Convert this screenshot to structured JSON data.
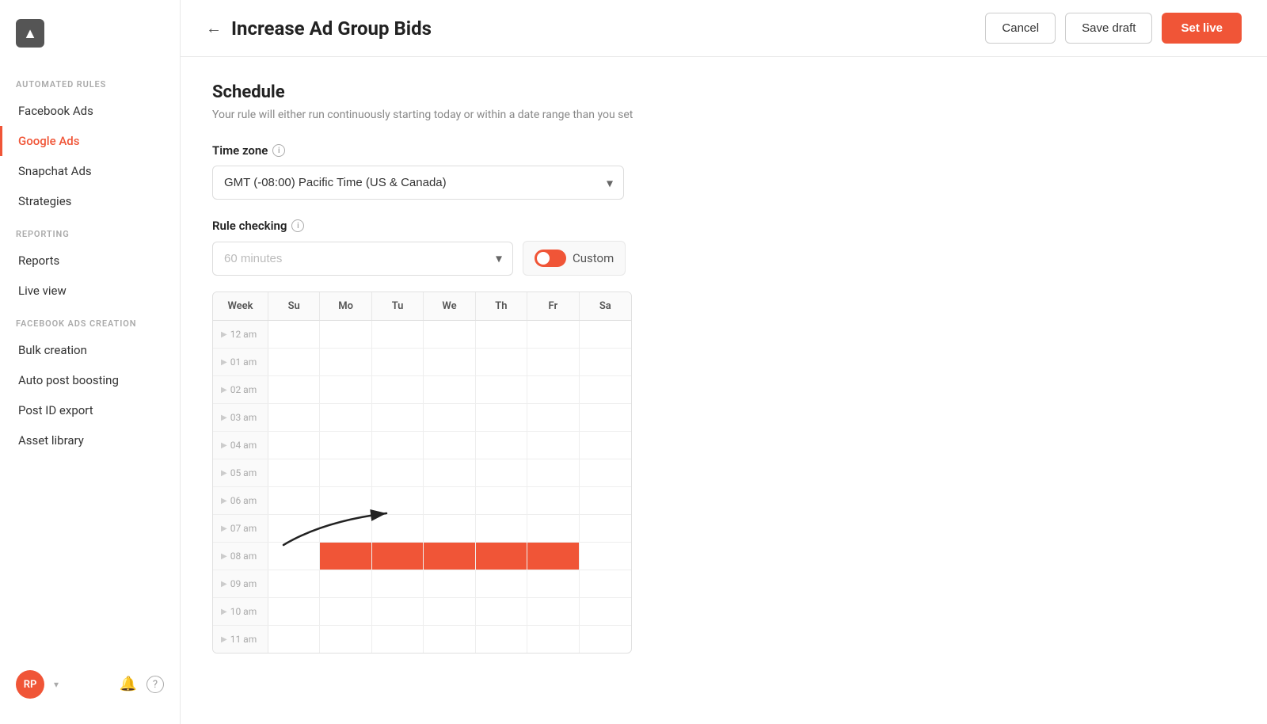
{
  "sidebar": {
    "logo_icon": "▲",
    "sections": [
      {
        "label": "AUTOMATED RULES",
        "items": [
          {
            "id": "facebook-ads",
            "label": "Facebook Ads",
            "active": false
          },
          {
            "id": "google-ads",
            "label": "Google Ads",
            "active": true
          },
          {
            "id": "snapchat-ads",
            "label": "Snapchat Ads",
            "active": false
          },
          {
            "id": "strategies",
            "label": "Strategies",
            "active": false
          }
        ]
      },
      {
        "label": "REPORTING",
        "items": [
          {
            "id": "reports",
            "label": "Reports",
            "active": false
          },
          {
            "id": "live-view",
            "label": "Live view",
            "active": false
          }
        ]
      },
      {
        "label": "FACEBOOK ADS CREATION",
        "items": [
          {
            "id": "bulk-creation",
            "label": "Bulk creation",
            "active": false
          },
          {
            "id": "auto-post-boosting",
            "label": "Auto post boosting",
            "active": false
          },
          {
            "id": "post-id-export",
            "label": "Post ID export",
            "active": false
          },
          {
            "id": "asset-library",
            "label": "Asset library",
            "active": false
          }
        ]
      }
    ],
    "footer": {
      "avatar_initials": "RP",
      "chevron_icon": "▾",
      "bell_icon": "🔔",
      "help_icon": "?"
    }
  },
  "header": {
    "back_label": "←",
    "page_title": "Increase Ad Group Bids",
    "cancel_label": "Cancel",
    "save_draft_label": "Save draft",
    "set_live_label": "Set live"
  },
  "schedule": {
    "title": "Schedule",
    "description": "Your rule will either run continuously starting today or within a date range than you set",
    "timezone_label": "Time zone",
    "timezone_info": "i",
    "timezone_value": "GMT (-08:00) Pacific Time (US & Canada)",
    "rule_checking_label": "Rule checking",
    "rule_checking_info": "i",
    "rule_checking_placeholder": "60 minutes",
    "custom_toggle_label": "Custom",
    "days_header": [
      "Week",
      "Su",
      "Mo",
      "Tu",
      "We",
      "Th",
      "Fr",
      "Sa"
    ],
    "hours": [
      "12 am",
      "01 am",
      "02 am",
      "03 am",
      "04 am",
      "05 am",
      "06 am",
      "07 am",
      "08 am",
      "09 am",
      "10 am",
      "11 am"
    ],
    "active_cells": [
      {
        "hour": 8,
        "day": 1
      },
      {
        "hour": 8,
        "day": 2
      },
      {
        "hour": 8,
        "day": 3
      },
      {
        "hour": 8,
        "day": 4
      },
      {
        "hour": 8,
        "day": 5
      }
    ]
  }
}
